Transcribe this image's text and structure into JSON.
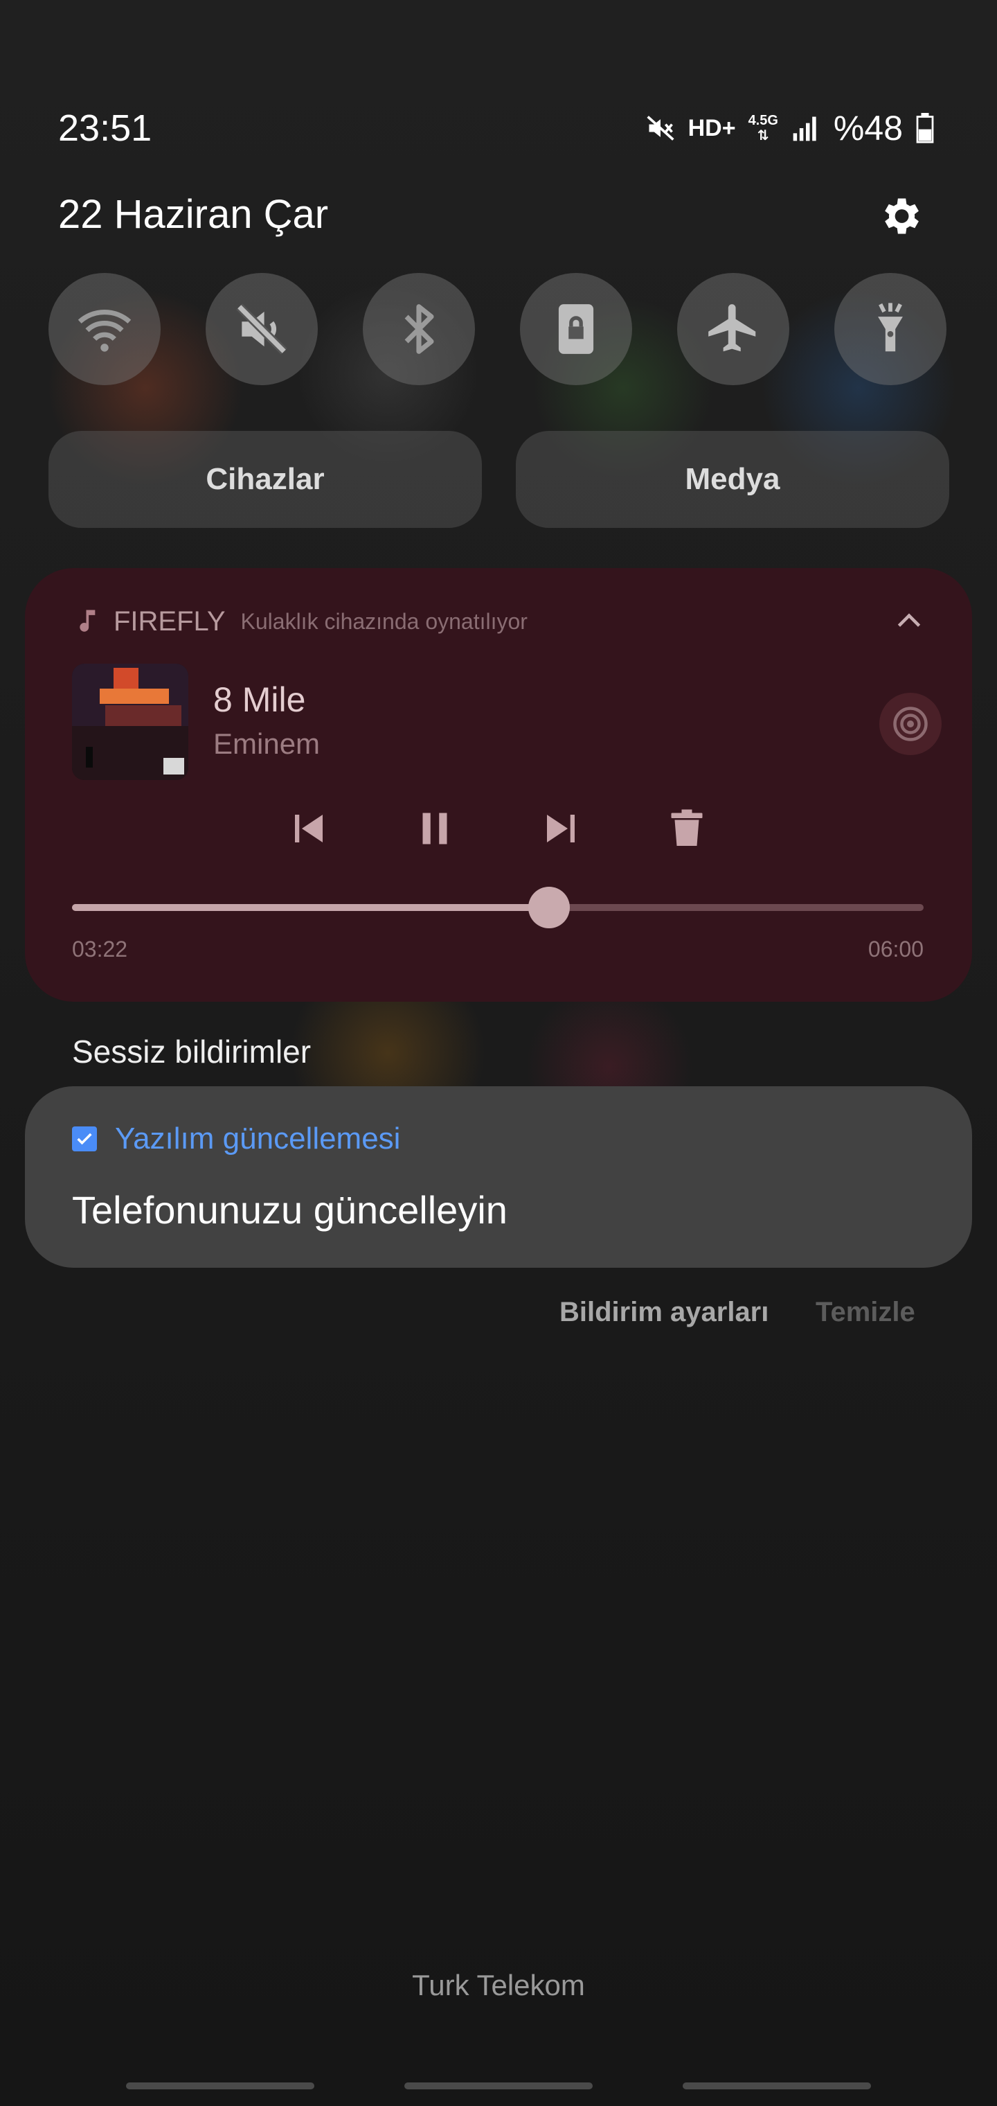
{
  "status_bar": {
    "time": "23:51",
    "hd_label": "HD+",
    "network_label": "4.5G",
    "battery_percent": "%48",
    "battery_level": 0.48
  },
  "header": {
    "date": "22 Haziran Çar"
  },
  "quick_toggles": [
    {
      "icon": "wifi-icon"
    },
    {
      "icon": "sound-off-icon"
    },
    {
      "icon": "bluetooth-icon"
    },
    {
      "icon": "screen-lock-icon"
    },
    {
      "icon": "airplane-icon"
    },
    {
      "icon": "flashlight-icon"
    }
  ],
  "pills": {
    "devices_label": "Cihazlar",
    "media_label": "Medya"
  },
  "media": {
    "app_name": "FIREFLY",
    "subtitle": "Kulaklık cihazında oynatılıyor",
    "track_title": "8 Mile",
    "artist": "Eminem",
    "current_time": "03:22",
    "total_time": "06:00",
    "progress": 0.56
  },
  "silent": {
    "section_label": "Sessiz bildirimler",
    "app_name": "Yazılım güncellemesi",
    "message": "Telefonunuzu güncelleyin"
  },
  "footer_actions": {
    "settings_label": "Bildirim ayarları",
    "clear_label": "Temizle"
  },
  "carrier": "Turk Telekom",
  "colors": {
    "media_card_bg": "#34141c",
    "accent_blue": "#4a8cf7"
  }
}
